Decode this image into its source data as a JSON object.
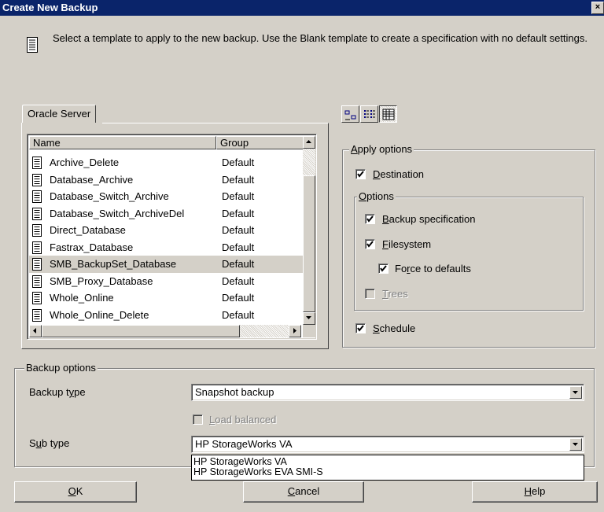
{
  "window": {
    "title": "Create New Backup",
    "close_label": "×"
  },
  "info": {
    "icon": "document-icon",
    "text": "Select a template to apply to the new backup. Use the Blank template to create a specification with no default settings."
  },
  "templates": {
    "tab_label": "Oracle Server",
    "columns": [
      "Name",
      "Group"
    ],
    "rows": [
      {
        "name": "Archive_Delete",
        "group": "Default"
      },
      {
        "name": "Database_Archive",
        "group": "Default"
      },
      {
        "name": "Database_Switch_Archive",
        "group": "Default"
      },
      {
        "name": "Database_Switch_ArchiveDel",
        "group": "Default"
      },
      {
        "name": "Direct_Database",
        "group": "Default"
      },
      {
        "name": "Fastrax_Database",
        "group": "Default"
      },
      {
        "name": "SMB_BackupSet_Database",
        "group": "Default",
        "selected": true
      },
      {
        "name": "SMB_Proxy_Database",
        "group": "Default"
      },
      {
        "name": "Whole_Online",
        "group": "Default"
      },
      {
        "name": "Whole_Online_Delete",
        "group": "Default"
      }
    ]
  },
  "view_buttons": [
    {
      "icon": "large-icons-view-icon",
      "pressed": false
    },
    {
      "icon": "list-view-icon",
      "pressed": false
    },
    {
      "icon": "details-view-icon",
      "pressed": true
    }
  ],
  "apply_options": {
    "legend_pre": "",
    "legend_u": "A",
    "legend_post": "pply options",
    "destination": {
      "pre": "",
      "u": "D",
      "post": "estination",
      "checked": true
    },
    "options_group": {
      "legend_pre": "",
      "legend_u": "O",
      "legend_post": "ptions",
      "backup_spec": {
        "pre": "",
        "u": "B",
        "post": "ackup specification",
        "checked": true
      },
      "filesystem": {
        "pre": "",
        "u": "F",
        "post": "ilesystem",
        "checked": true
      },
      "force_defaults": {
        "pre": "Fo",
        "u": "r",
        "post": "ce to defaults",
        "checked": true
      },
      "trees": {
        "pre": "",
        "u": "T",
        "post": "rees",
        "checked": false,
        "disabled": true
      }
    },
    "schedule": {
      "pre": "",
      "u": "S",
      "post": "chedule",
      "checked": true
    }
  },
  "backup_options": {
    "legend": "Backup options",
    "backup_type": {
      "label_pre": "Backup t",
      "label_u": "y",
      "label_post": "pe",
      "value": "Snapshot backup"
    },
    "load_balanced": {
      "pre": "",
      "u": "L",
      "post": "oad balanced",
      "checked": false,
      "disabled": true
    },
    "sub_type": {
      "label_pre": "S",
      "label_u": "u",
      "label_post": "b type",
      "value": "HP StorageWorks VA",
      "options": [
        "HP StorageWorks VA",
        "HP StorageWorks EVA SMI-S"
      ]
    }
  },
  "buttons": {
    "ok": {
      "pre": "",
      "u": "O",
      "post": "K"
    },
    "cancel": {
      "pre": "",
      "u": "C",
      "post": "ancel"
    },
    "help": {
      "pre": "",
      "u": "H",
      "post": "elp"
    }
  }
}
